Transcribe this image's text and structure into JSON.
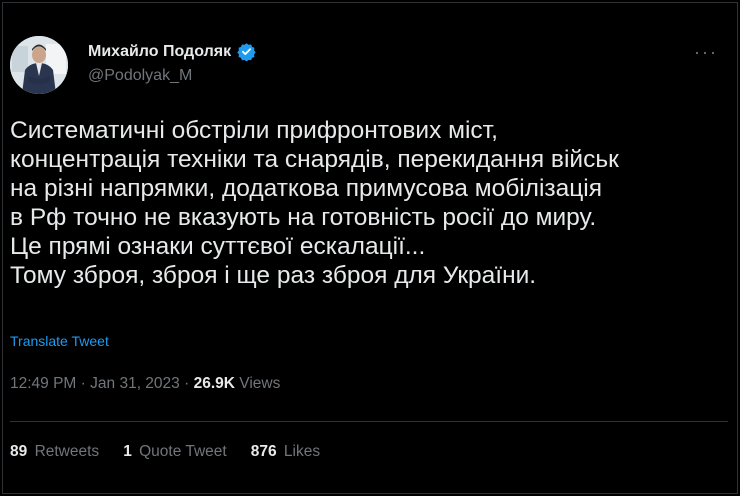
{
  "author": {
    "display_name": "Михайло Подоляк",
    "handle": "@Podolyak_M"
  },
  "tweet": {
    "lines": [
      "Систематичні обстріли прифронтових міст,",
      "концентрація техніки та снарядів, перекидання військ",
      "на різні напрямки, додаткова примусова мобілізація",
      "в Рф точно не вказують на готовність росії до миру.",
      "Це прямі ознаки суттєвої ескалації...",
      "Тому зброя, зброя і ще раз зброя для України."
    ],
    "translate_label": "Translate Tweet",
    "time": "12:49 PM",
    "date": "Jan 31, 2023",
    "separator": "·",
    "views_count": "26.9K",
    "views_label": "Views"
  },
  "stats": {
    "retweets_count": "89",
    "retweets_label": "Retweets",
    "quotes_count": "1",
    "quotes_label": "Quote Tweet",
    "likes_count": "876",
    "likes_label": "Likes"
  },
  "more_icon": "more-horizontal-icon",
  "colors": {
    "background": "#000000",
    "text": "#e7e9ea",
    "secondary": "#71767b",
    "accent": "#1d9bf0",
    "border": "#2f3336"
  }
}
